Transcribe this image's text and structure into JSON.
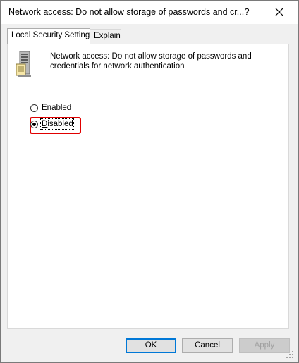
{
  "window": {
    "title": "Network access: Do not allow storage of passwords and cr...",
    "help_label": "?",
    "close_label": "×"
  },
  "tabs": [
    {
      "label": "Local Security Setting",
      "active": true
    },
    {
      "label": "Explain",
      "active": false
    }
  ],
  "policy": {
    "icon": "server-policy-icon",
    "description": "Network access: Do not allow storage of passwords and credentials for network authentication"
  },
  "options": [
    {
      "label_prefix": "",
      "label_accel": "E",
      "label_rest": "nabled",
      "selected": false
    },
    {
      "label_prefix": "",
      "label_accel": "D",
      "label_rest": "isabled",
      "selected": true
    }
  ],
  "buttons": {
    "ok": "OK",
    "cancel": "Cancel",
    "apply": "Apply"
  },
  "colors": {
    "highlight": "#e00000",
    "default_button_border": "#0078d7"
  }
}
